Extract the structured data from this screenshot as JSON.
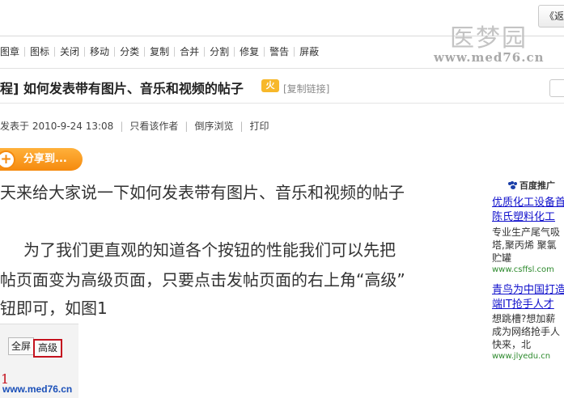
{
  "header": {
    "reply_button": "《返",
    "watermark_logo": "医梦园",
    "watermark_url": "www.med76.cn"
  },
  "mod_toolbar": [
    "图章",
    "图标",
    "关闭",
    "移动",
    "分类",
    "复制",
    "合并",
    "分割",
    "修复",
    "警告",
    "屏蔽"
  ],
  "thread": {
    "title": "程] 如何发表带有图片、音乐和视频的帖子",
    "badge": "火",
    "copy_link": "[复制链接]"
  },
  "post_meta": {
    "posted_at": "发表于 2010-9-24 13:08",
    "only_author": "只看该作者",
    "reverse_view": "倒序浏览",
    "print": "打印"
  },
  "share": {
    "icon": "plus-icon",
    "label": "分享到..."
  },
  "post_body": {
    "line1": "天来给大家说一下如何发表带有图片、音乐和视频的帖子",
    "line2": "为了我们更直观的知道各个按钮的性能我们可以先把",
    "line3": "帖页面变为高级页面，只要点击发帖页面的右上角“高级”",
    "line4": "钮即可，如图1"
  },
  "figure": {
    "button_full": "全屏",
    "button_advanced": "高级",
    "number": "1",
    "watermark": "www.med76.cn"
  },
  "ads": {
    "header": "百度推广",
    "ad1": {
      "title1": "优质化工设备首",
      "title2": "陈氏塑料化工",
      "desc1": "专业生产尾气吸",
      "desc2": "塔,聚丙烯 聚氯",
      "desc3": "贮罐",
      "url": "www.csffsl.com"
    },
    "ad2": {
      "title1": "青鸟为中国打造",
      "title2": "端IT抢手人才",
      "desc1": "想跳槽?想加薪",
      "desc2": "成为网络抢手人",
      "desc3": "快来，北",
      "url": "www.jlyedu.cn"
    }
  },
  "colors": {
    "share_orange": "#f58a0e",
    "ad_link": "#1111cc",
    "ad_url": "#2d8a2d",
    "figure_highlight": "#c4121e"
  }
}
